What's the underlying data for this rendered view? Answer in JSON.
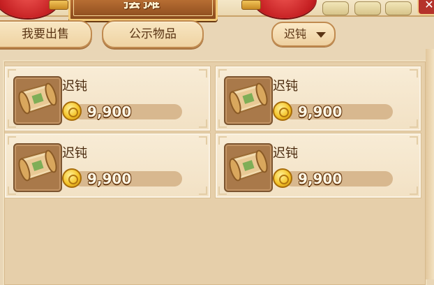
{
  "header": {
    "title": "摆摊",
    "close_glyph": "✕"
  },
  "tabs": [
    {
      "label": "我要出售"
    },
    {
      "label": "公示物品"
    }
  ],
  "filter": {
    "selected": "迟钝",
    "icon": "triangle-down-icon"
  },
  "listings": [
    {
      "name": "迟钝",
      "price": "9,900",
      "icon": "scroll-icon",
      "currency_icon": "gold-coin-icon"
    },
    {
      "name": "迟钝",
      "price": "9,900",
      "icon": "scroll-icon",
      "currency_icon": "gold-coin-icon"
    },
    {
      "name": "迟钝",
      "price": "9,900",
      "icon": "scroll-icon",
      "currency_icon": "gold-coin-icon"
    },
    {
      "name": "迟钝",
      "price": "9,900",
      "icon": "scroll-icon",
      "currency_icon": "gold-coin-icon"
    }
  ],
  "colors": {
    "panel": "#e6cfaa",
    "card": "#f8ecd6",
    "tab_border": "#c08a4f",
    "text_dark": "#4a2a0e",
    "lantern_red": "#c51f22"
  }
}
